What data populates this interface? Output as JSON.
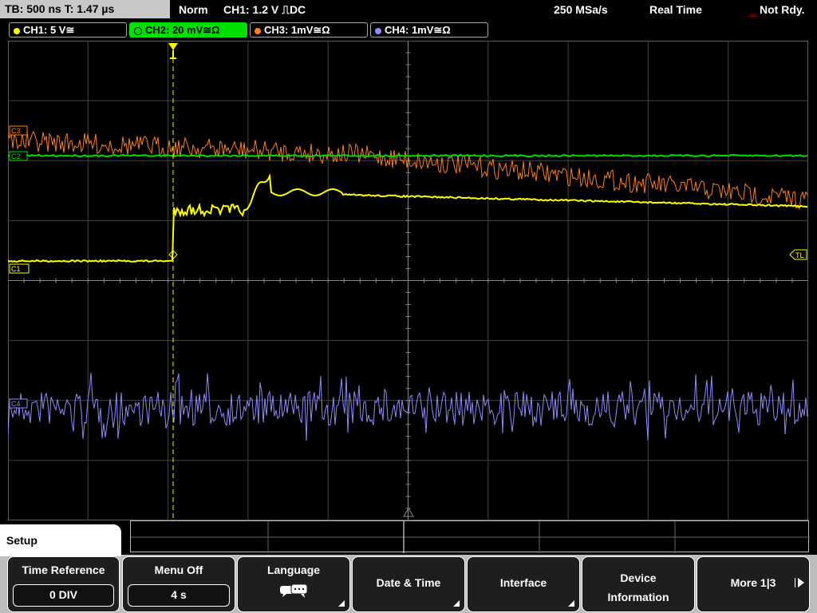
{
  "status_bar": {
    "timebase": "TB: 500 ns   T: 1.47 µs",
    "trigger_mode": "Norm",
    "trigger_info": "CH1: 1.2 V ⎍DC",
    "sample_rate": "250 MSa/s",
    "acq_mode": "Real Time",
    "ready_state": "Not Rdy."
  },
  "channels": [
    {
      "label": "CH1: 5 V≅",
      "color": "#ffff00"
    },
    {
      "label": "CH2: 20 mV≅Ω",
      "color": "#00e000"
    },
    {
      "label": "CH3: 1mV≅Ω",
      "color": "#ff7f1a"
    },
    {
      "label": "CH4: 1mV≅Ω",
      "color": "#8c8cff"
    }
  ],
  "markers": {
    "ch3": "C3",
    "ch2": "C2",
    "ch1": "C1",
    "ch4": "C4",
    "trigger_level": "TL"
  },
  "setup_tab": "Setup",
  "softkeys": {
    "time_reference": {
      "label": "Time Reference",
      "value": "0 DIV"
    },
    "menu_off": {
      "label": "Menu Off",
      "value": "4 s"
    },
    "language": {
      "label": "Language"
    },
    "date_time": {
      "label": "Date & Time"
    },
    "interface": {
      "label": "Interface"
    },
    "device_info": {
      "label_line1": "Device",
      "label_line2": "Information"
    },
    "more": {
      "label": "More 1|3"
    }
  },
  "colors": {
    "grid": "#555555",
    "trigger_line": "#ffff00"
  }
}
